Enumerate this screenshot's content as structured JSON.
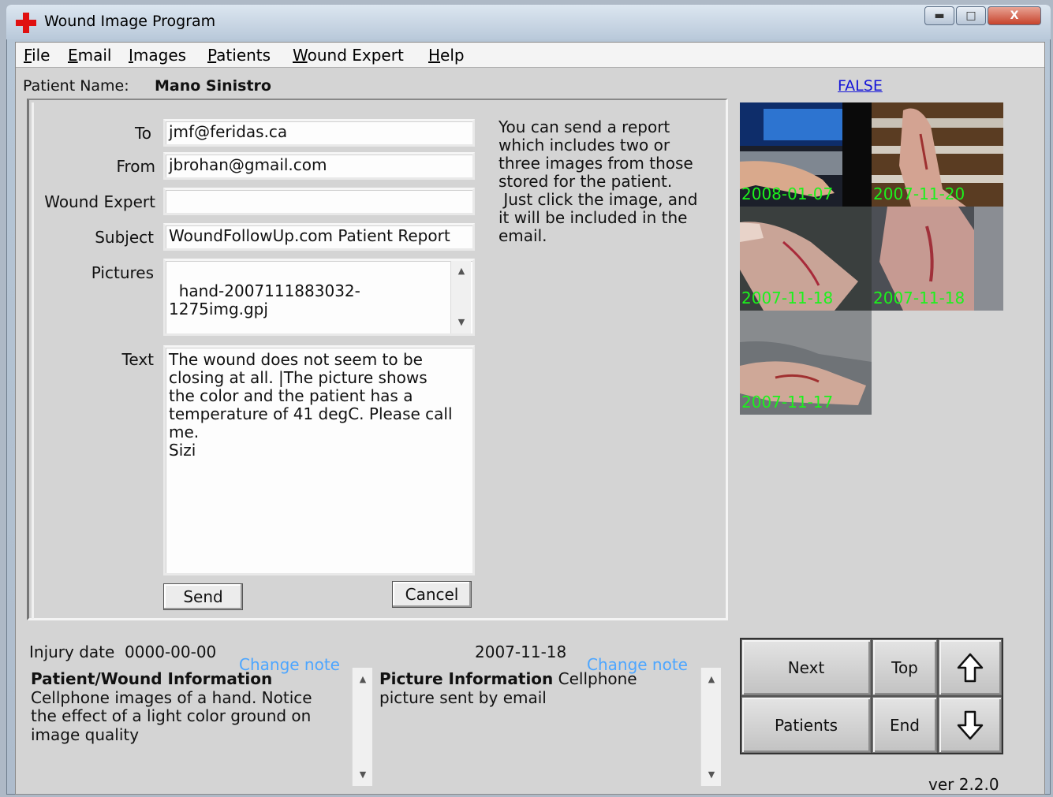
{
  "window": {
    "title": "Wound Image Program"
  },
  "menu": [
    "File",
    "Email",
    "Images",
    "Patients",
    "Wound Expert",
    "Help"
  ],
  "patient": {
    "label": "Patient Name:",
    "name": "Mano Sinistro",
    "flag_link": "FALSE"
  },
  "email_form": {
    "to_label": "To",
    "to_value": "jmf@feridas.ca",
    "from_label": "From",
    "from_value": "jbrohan@gmail.com",
    "expert_label": "Wound Expert",
    "expert_value": "",
    "subject_label": "Subject",
    "subject_value": "WoundFollowUp.com Patient Report",
    "pictures_label": "Pictures",
    "pictures_value": "hand-2007111883032-\n1275img.gpj",
    "text_label": "Text",
    "text_value": "The wound does not seem to be\nclosing at all. |The picture shows\nthe color and the patient has a\ntemperature of 41 degC. Please call\nme.\nSizi",
    "send_label": "Send",
    "cancel_label": "Cancel"
  },
  "instructions": "You can send a report\nwhich includes two or\nthree images from those\nstored for the patient.\n Just click the image, and\nit will be included in the\nemail.",
  "thumbnails": [
    {
      "date": "2008-01-07"
    },
    {
      "date": "2007-11-20"
    },
    {
      "date": "2007-11-18"
    },
    {
      "date": "2007-11-18"
    },
    {
      "date": "2007-11-17"
    }
  ],
  "patient_info": {
    "injury_label": "Injury date",
    "injury_date": "0000-00-00",
    "change_note": "Change note",
    "title": "Patient/Wound Information",
    "text": "Cellphone images of a hand. Notice\nthe effect of a light color ground on\nimage quality"
  },
  "picture_info": {
    "date": "2007-11-18",
    "change_note": "Change note",
    "title": "Picture Information",
    "text_inline": " Cellphone",
    "text": "picture sent by email"
  },
  "nav": {
    "next": "Next",
    "top": "Top",
    "patients": "Patients",
    "end": "End",
    "up_icon": "up-arrow-icon",
    "down_icon": "down-arrow-icon"
  },
  "version": "ver 2.2.0",
  "colors": {
    "thumb_date": "#1cf21c",
    "change_note": "#4da6ff",
    "link": "#1515d8",
    "brand_cross": "#e01010"
  }
}
